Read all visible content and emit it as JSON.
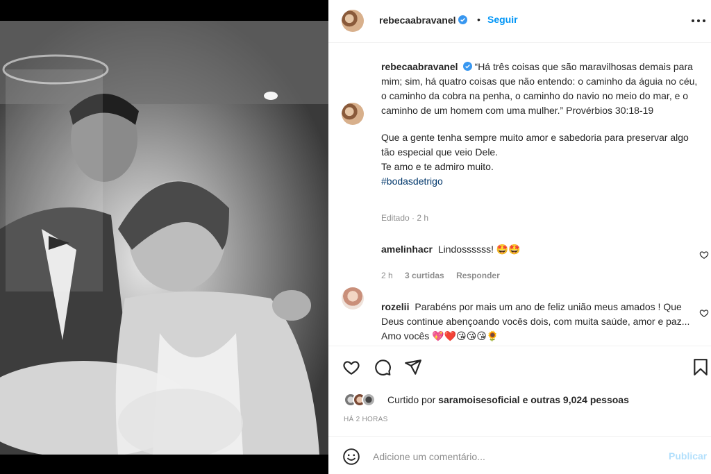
{
  "post": {
    "username": "rebecaabravanel",
    "verified": true,
    "separator": "•",
    "follow_label": "Seguir",
    "more_icon": "more-horizontal-icon"
  },
  "caption": {
    "username": "rebecaabravanel",
    "text1": "“Há três coisas que são maravilhosas demais para mim; sim, há quatro coisas que não entendo: o caminho da águia no céu, o caminho da cobra na penha, o caminho do navio no meio do mar, e o caminho de um homem com uma mulher.” Provérbios 30:18-19",
    "text2_line1": "Que a gente tenha sempre muito amor e sabedoria para preservar algo tão especial que veio Dele.",
    "text2_line2": "Te amo e te admiro muito.",
    "hashtag": "#bodasdetrigo",
    "meta": "Editado · 2 h"
  },
  "comments": [
    {
      "username": "amelinhacr",
      "text": "Lindossssss! 🤩🤩",
      "time": "2 h",
      "likes": "3 curtidas",
      "reply": "Responder"
    },
    {
      "username": "rozelii",
      "text": "Parabéns por mais um ano de feliz união meus amados ! Que Deus continue abençoando vocês dois, com muita saúde, amor e paz... Amo vocês 💖❤️😘😘😘🌻"
    }
  ],
  "actions": {
    "like_icon": "heart-icon",
    "comment_icon": "comment-icon",
    "share_icon": "paper-plane-icon",
    "save_icon": "bookmark-icon"
  },
  "likes": {
    "prefix": "Curtido por",
    "user": "saramoisesoficial",
    "suffix": "e outras 9,024 pessoas"
  },
  "time_ago": "HÁ 2 HORAS",
  "add_comment": {
    "placeholder": "Adicione um comentário...",
    "publish_label": "Publicar"
  },
  "colors": {
    "link_blue": "#0095f6",
    "publish_disabled": "#b2dffc",
    "text": "#262626",
    "muted": "#8e8e8e"
  }
}
